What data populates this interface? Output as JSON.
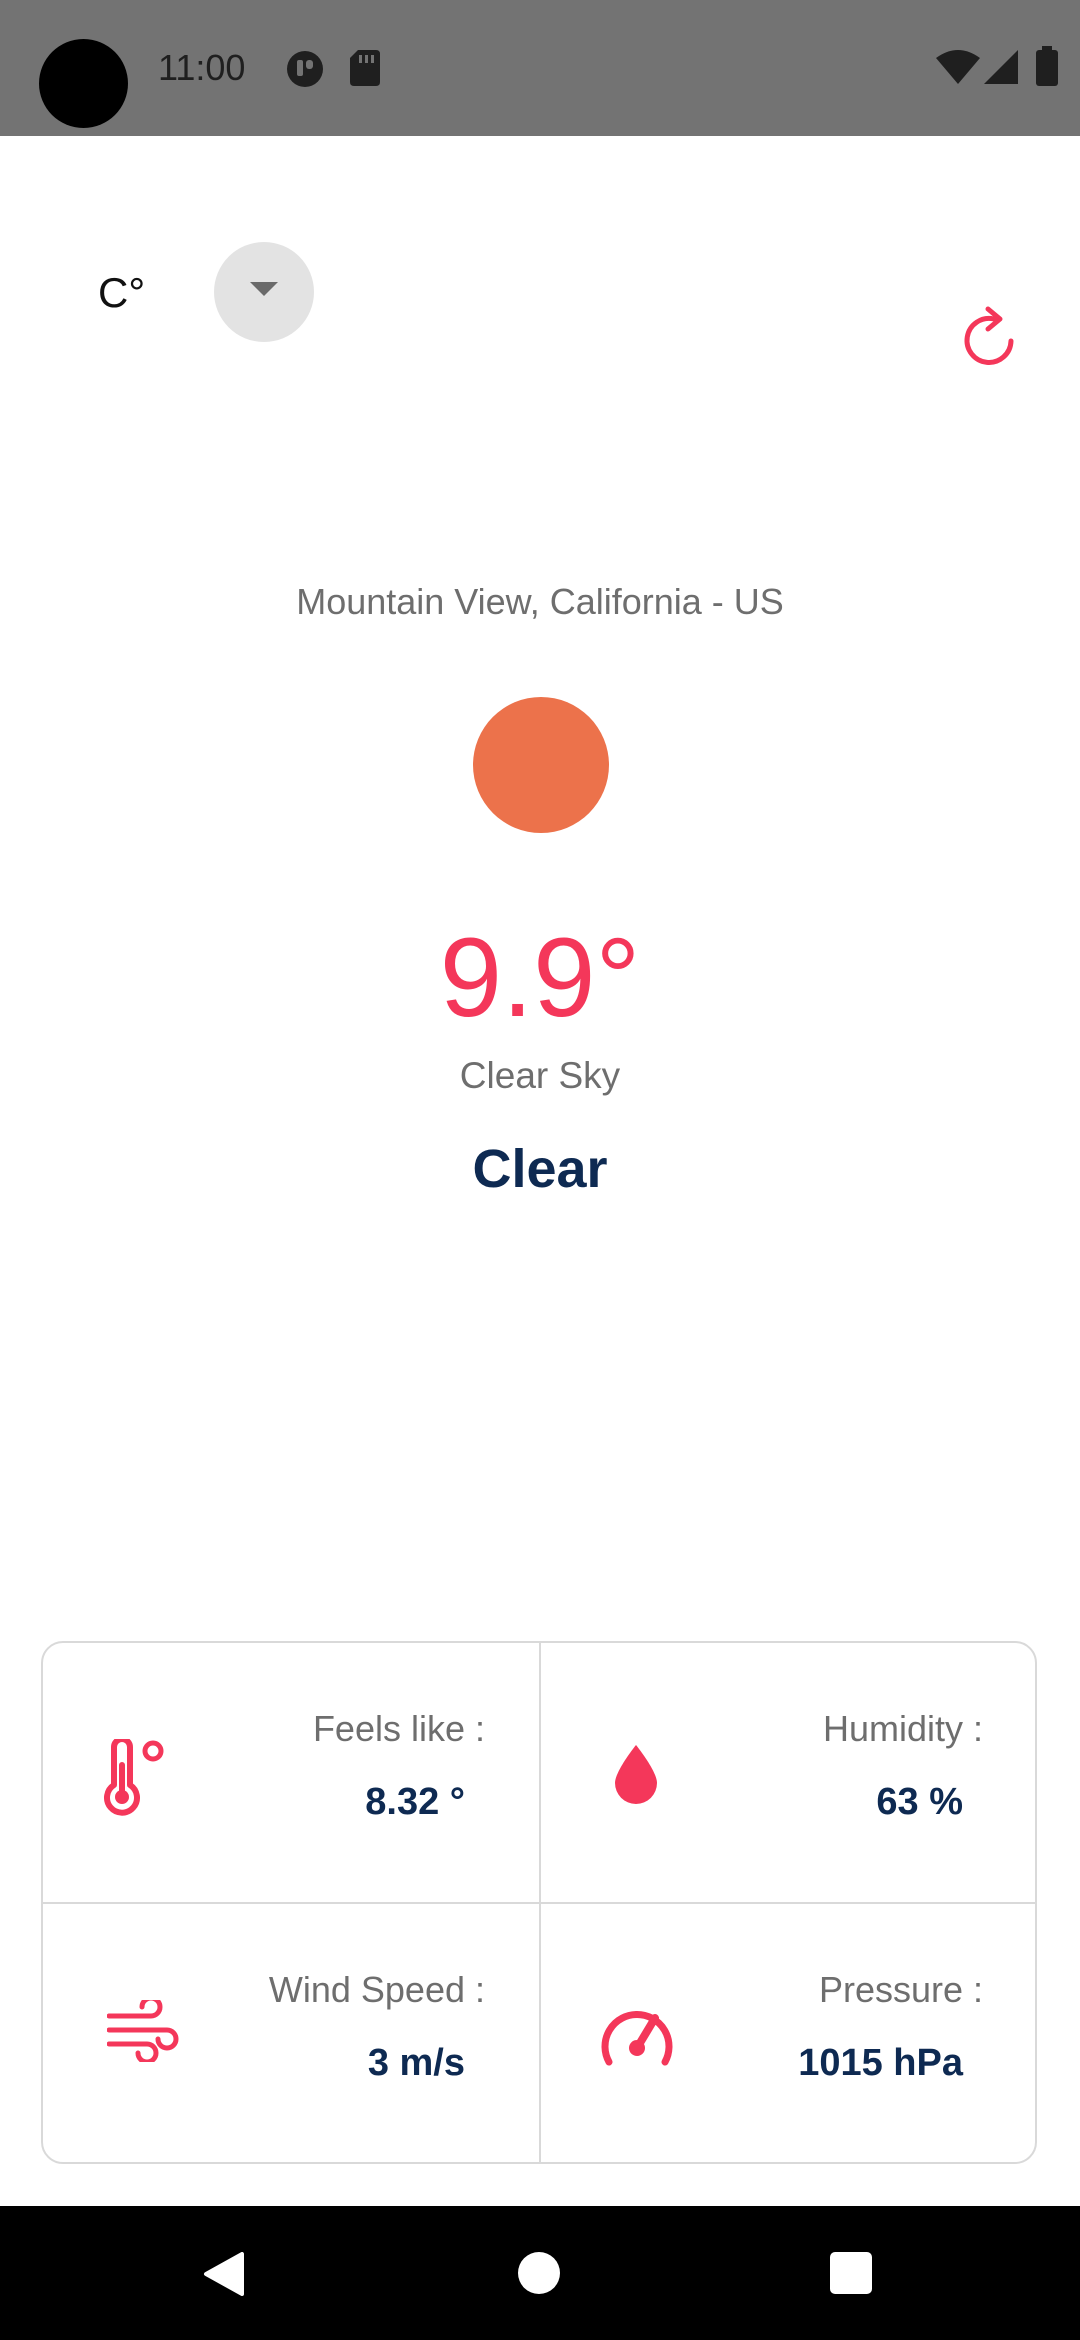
{
  "status_bar": {
    "time": "11:00",
    "icons": [
      "camera-hole",
      "notification-icon",
      "sd-card-icon",
      "wifi-icon",
      "signal-icon",
      "battery-icon"
    ]
  },
  "controls": {
    "unit_label": "C°",
    "unit_dropdown_icon": "chevron-down-icon",
    "refresh_icon": "refresh-icon"
  },
  "weather": {
    "location": "Mountain View, California - US",
    "icon_color": "#ec724b",
    "temperature": "9.9°",
    "description": "Clear Sky",
    "main": "Clear"
  },
  "details": {
    "feels_like": {
      "label": "Feels like :",
      "value": "8.32 °",
      "icon": "thermometer-icon"
    },
    "humidity": {
      "label": "Humidity :",
      "value": "63 %",
      "icon": "water-drop-icon"
    },
    "wind_speed": {
      "label": "Wind Speed :",
      "value": "3 m/s",
      "icon": "wind-icon"
    },
    "pressure": {
      "label": "Pressure :",
      "value": "1015 hPa",
      "icon": "speedometer-icon"
    }
  },
  "colors": {
    "accent": "#f4375a",
    "primary_text": "#0e2a52",
    "secondary_text": "#6e6e6e",
    "status_bar": "#737373"
  },
  "nav_bar": {
    "buttons": [
      "back-icon",
      "home-icon",
      "recents-icon"
    ]
  }
}
